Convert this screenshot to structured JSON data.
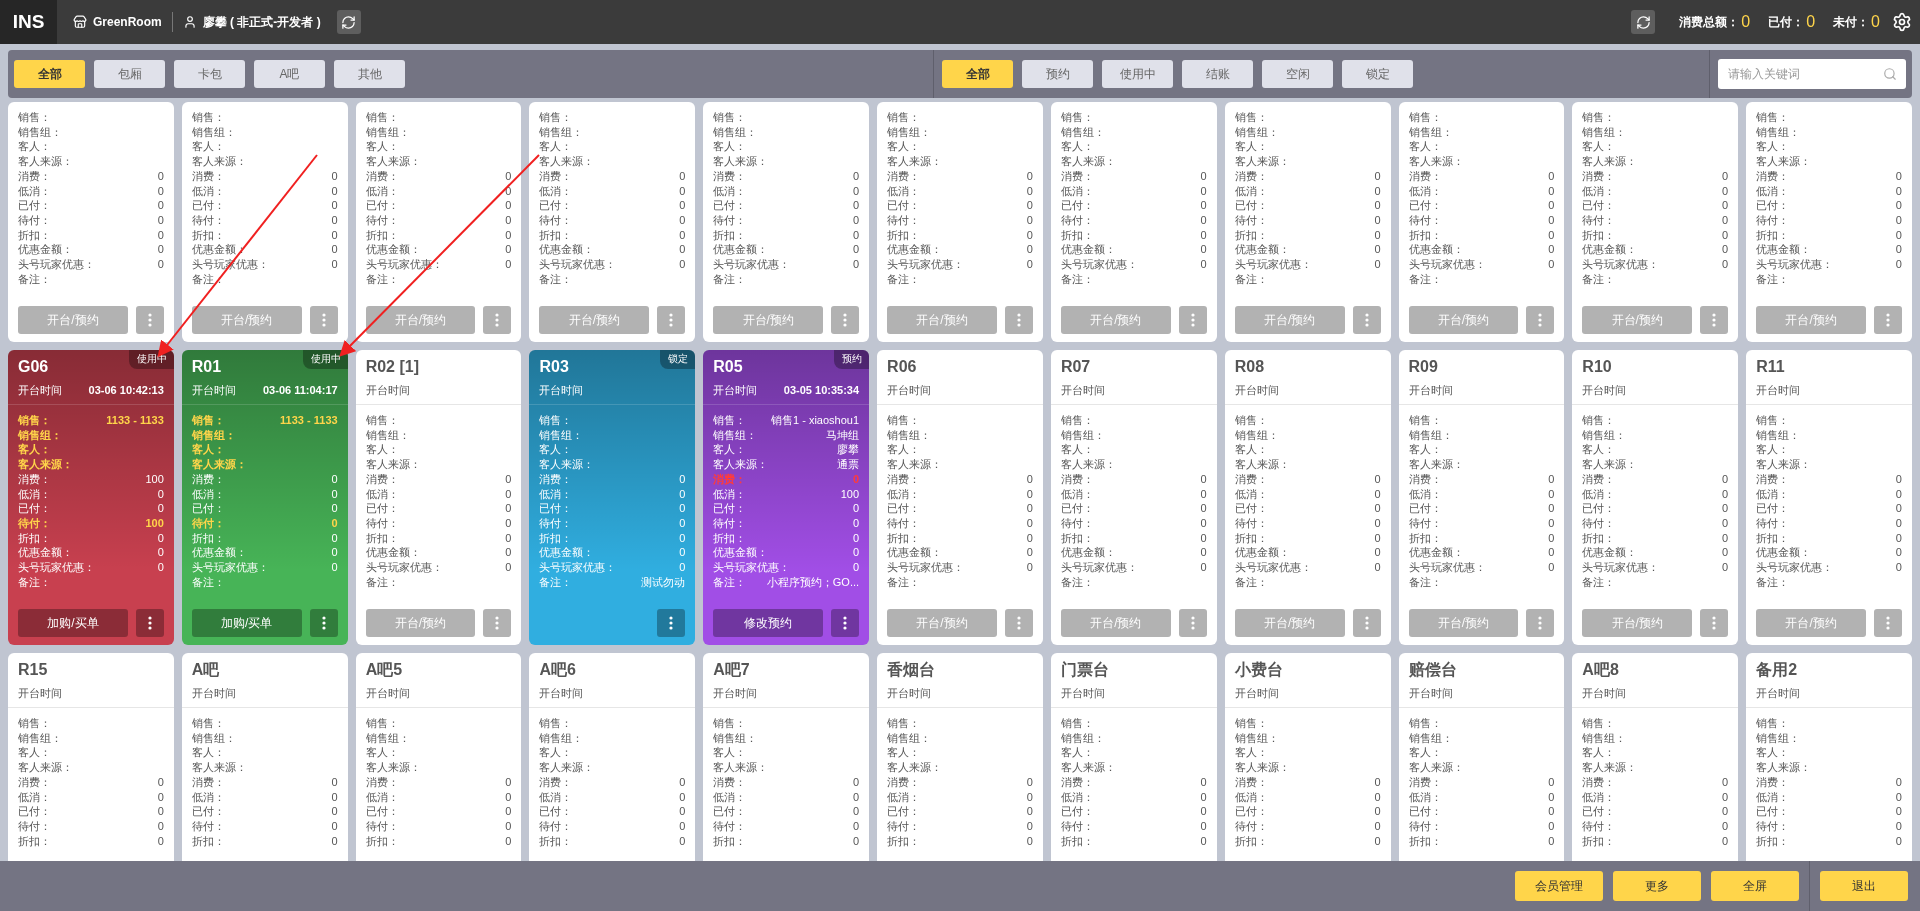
{
  "top_bar": {
    "logo": "INS",
    "store": "GreenRoom",
    "user": "廖攀 ( 非正式-开发者 )",
    "summary": [
      {
        "label": "消费总额：",
        "value": "0"
      },
      {
        "label": "已付：",
        "value": "0"
      },
      {
        "label": "未付：",
        "value": "0"
      }
    ]
  },
  "area_tabs": [
    {
      "label": "全部",
      "selected": true
    },
    {
      "label": "包厢",
      "selected": false
    },
    {
      "label": "卡包",
      "selected": false
    },
    {
      "label": "A吧",
      "selected": false
    },
    {
      "label": "其他",
      "selected": false
    }
  ],
  "status_tabs": [
    {
      "label": "全部",
      "selected": true
    },
    {
      "label": "预约",
      "selected": false
    },
    {
      "label": "使用中",
      "selected": false
    },
    {
      "label": "结账",
      "selected": false
    },
    {
      "label": "空闲",
      "selected": false
    },
    {
      "label": "锁定",
      "selected": false
    }
  ],
  "search": {
    "placeholder": "请输入关键词"
  },
  "rooms": [
    {
      "action": "开台/预约",
      "fields": [
        {
          "label": "销售："
        },
        {
          "label": "销售组："
        },
        {
          "label": "客人："
        },
        {
          "label": "客人来源："
        },
        {
          "label": "消费：",
          "value": "0"
        },
        {
          "label": "低消：",
          "value": "0"
        },
        {
          "label": "已付：",
          "value": "0"
        },
        {
          "label": "待付：",
          "value": "0"
        },
        {
          "label": "折扣：",
          "value": "0"
        },
        {
          "label": "优惠金额：",
          "value": "0"
        },
        {
          "label": "头号玩家优惠：",
          "value": "0"
        },
        {
          "label": "备注："
        }
      ]
    },
    {
      "action": "开台/预约",
      "fields": [
        {
          "label": "销售："
        },
        {
          "label": "销售组："
        },
        {
          "label": "客人："
        },
        {
          "label": "客人来源："
        },
        {
          "label": "消费：",
          "value": "0"
        },
        {
          "label": "低消：",
          "value": "0"
        },
        {
          "label": "已付：",
          "value": "0"
        },
        {
          "label": "待付：",
          "value": "0"
        },
        {
          "label": "折扣：",
          "value": "0"
        },
        {
          "label": "优惠金额：",
          "value": "0"
        },
        {
          "label": "头号玩家优惠：",
          "value": "0"
        },
        {
          "label": "备注："
        }
      ]
    },
    {
      "action": "开台/预约",
      "fields": [
        {
          "label": "销售："
        },
        {
          "label": "销售组："
        },
        {
          "label": "客人："
        },
        {
          "label": "客人来源："
        },
        {
          "label": "消费：",
          "value": "0"
        },
        {
          "label": "低消：",
          "value": "0"
        },
        {
          "label": "已付：",
          "value": "0"
        },
        {
          "label": "待付：",
          "value": "0"
        },
        {
          "label": "折扣：",
          "value": "0"
        },
        {
          "label": "优惠金额：",
          "value": "0"
        },
        {
          "label": "头号玩家优惠：",
          "value": "0"
        },
        {
          "label": "备注："
        }
      ]
    },
    {
      "action": "开台/预约",
      "fields": [
        {
          "label": "销售："
        },
        {
          "label": "销售组："
        },
        {
          "label": "客人："
        },
        {
          "label": "客人来源："
        },
        {
          "label": "消费：",
          "value": "0"
        },
        {
          "label": "低消：",
          "value": "0"
        },
        {
          "label": "已付：",
          "value": "0"
        },
        {
          "label": "待付：",
          "value": "0"
        },
        {
          "label": "折扣：",
          "value": "0"
        },
        {
          "label": "优惠金额：",
          "value": "0"
        },
        {
          "label": "头号玩家优惠：",
          "value": "0"
        },
        {
          "label": "备注："
        }
      ]
    },
    {
      "action": "开台/预约",
      "fields": [
        {
          "label": "销售："
        },
        {
          "label": "销售组："
        },
        {
          "label": "客人："
        },
        {
          "label": "客人来源："
        },
        {
          "label": "消费：",
          "value": "0"
        },
        {
          "label": "低消：",
          "value": "0"
        },
        {
          "label": "已付：",
          "value": "0"
        },
        {
          "label": "待付：",
          "value": "0"
        },
        {
          "label": "折扣：",
          "value": "0"
        },
        {
          "label": "优惠金额：",
          "value": "0"
        },
        {
          "label": "头号玩家优惠：",
          "value": "0"
        },
        {
          "label": "备注："
        }
      ]
    },
    {
      "action": "开台/预约",
      "fields": [
        {
          "label": "销售："
        },
        {
          "label": "销售组："
        },
        {
          "label": "客人："
        },
        {
          "label": "客人来源："
        },
        {
          "label": "消费：",
          "value": "0"
        },
        {
          "label": "低消：",
          "value": "0"
        },
        {
          "label": "已付：",
          "value": "0"
        },
        {
          "label": "待付：",
          "value": "0"
        },
        {
          "label": "折扣：",
          "value": "0"
        },
        {
          "label": "优惠金额：",
          "value": "0"
        },
        {
          "label": "头号玩家优惠：",
          "value": "0"
        },
        {
          "label": "备注："
        }
      ]
    },
    {
      "action": "开台/预约",
      "fields": [
        {
          "label": "销售："
        },
        {
          "label": "销售组："
        },
        {
          "label": "客人："
        },
        {
          "label": "客人来源："
        },
        {
          "label": "消费：",
          "value": "0"
        },
        {
          "label": "低消：",
          "value": "0"
        },
        {
          "label": "已付：",
          "value": "0"
        },
        {
          "label": "待付：",
          "value": "0"
        },
        {
          "label": "折扣：",
          "value": "0"
        },
        {
          "label": "优惠金额：",
          "value": "0"
        },
        {
          "label": "头号玩家优惠：",
          "value": "0"
        },
        {
          "label": "备注："
        }
      ]
    },
    {
      "action": "开台/预约",
      "fields": [
        {
          "label": "销售："
        },
        {
          "label": "销售组："
        },
        {
          "label": "客人："
        },
        {
          "label": "客人来源："
        },
        {
          "label": "消费：",
          "value": "0"
        },
        {
          "label": "低消：",
          "value": "0"
        },
        {
          "label": "已付：",
          "value": "0"
        },
        {
          "label": "待付：",
          "value": "0"
        },
        {
          "label": "折扣：",
          "value": "0"
        },
        {
          "label": "优惠金额：",
          "value": "0"
        },
        {
          "label": "头号玩家优惠：",
          "value": "0"
        },
        {
          "label": "备注："
        }
      ]
    },
    {
      "action": "开台/预约",
      "fields": [
        {
          "label": "销售："
        },
        {
          "label": "销售组："
        },
        {
          "label": "客人："
        },
        {
          "label": "客人来源："
        },
        {
          "label": "消费：",
          "value": "0"
        },
        {
          "label": "低消：",
          "value": "0"
        },
        {
          "label": "已付：",
          "value": "0"
        },
        {
          "label": "待付：",
          "value": "0"
        },
        {
          "label": "折扣：",
          "value": "0"
        },
        {
          "label": "优惠金额：",
          "value": "0"
        },
        {
          "label": "头号玩家优惠：",
          "value": "0"
        },
        {
          "label": "备注："
        }
      ]
    },
    {
      "action": "开台/预约",
      "fields": [
        {
          "label": "销售："
        },
        {
          "label": "销售组："
        },
        {
          "label": "客人："
        },
        {
          "label": "客人来源："
        },
        {
          "label": "消费：",
          "value": "0"
        },
        {
          "label": "低消：",
          "value": "0"
        },
        {
          "label": "已付：",
          "value": "0"
        },
        {
          "label": "待付：",
          "value": "0"
        },
        {
          "label": "折扣：",
          "value": "0"
        },
        {
          "label": "优惠金额：",
          "value": "0"
        },
        {
          "label": "头号玩家优惠：",
          "value": "0"
        },
        {
          "label": "备注："
        }
      ]
    },
    {
      "action": "开台/预约",
      "fields": [
        {
          "label": "销售："
        },
        {
          "label": "销售组："
        },
        {
          "label": "客人："
        },
        {
          "label": "客人来源："
        },
        {
          "label": "消费：",
          "value": "0"
        },
        {
          "label": "低消：",
          "value": "0"
        },
        {
          "label": "已付：",
          "value": "0"
        },
        {
          "label": "待付：",
          "value": "0"
        },
        {
          "label": "折扣：",
          "value": "0"
        },
        {
          "label": "优惠金额：",
          "value": "0"
        },
        {
          "label": "头号玩家优惠：",
          "value": "0"
        },
        {
          "label": "备注："
        }
      ]
    },
    {
      "title": "G06",
      "badge": "使用中",
      "color": "#c8404f",
      "open_time_label": "开台时间",
      "open_time": "03-06 10:42:13",
      "action": "加购/买单",
      "fields": [
        {
          "label": "销售：",
          "value": "1133 - 1133",
          "color": "#ffd54a"
        },
        {
          "label": "销售组：",
          "color": "#ffd54a"
        },
        {
          "label": "客人：",
          "color": "#ffd54a"
        },
        {
          "label": "客人来源：",
          "color": "#ffd54a"
        },
        {
          "label": "消费：",
          "value": "100"
        },
        {
          "label": "低消：",
          "value": "0"
        },
        {
          "label": "已付：",
          "value": "0"
        },
        {
          "label": "待付：",
          "value": "100",
          "color": "#ffd54a"
        },
        {
          "label": "折扣：",
          "value": "0"
        },
        {
          "label": "优惠金额：",
          "value": "0"
        },
        {
          "label": "头号玩家优惠：",
          "value": "0"
        },
        {
          "label": "备注："
        }
      ]
    },
    {
      "title": "R01",
      "badge": "使用中",
      "color": "#47b457",
      "open_time_label": "开台时间",
      "open_time": "03-06 11:04:17",
      "action": "加购/买单",
      "fields": [
        {
          "label": "销售：",
          "value": "1133 - 1133",
          "color": "#ffd54a"
        },
        {
          "label": "销售组：",
          "color": "#ffd54a"
        },
        {
          "label": "客人：",
          "color": "#ffd54a"
        },
        {
          "label": "客人来源：",
          "color": "#ffd54a"
        },
        {
          "label": "消费：",
          "value": "0"
        },
        {
          "label": "低消：",
          "value": "0"
        },
        {
          "label": "已付：",
          "value": "0"
        },
        {
          "label": "待付：",
          "value": "0",
          "color": "#ffd54a"
        },
        {
          "label": "折扣：",
          "value": "0"
        },
        {
          "label": "优惠金额：",
          "value": "0"
        },
        {
          "label": "头号玩家优惠：",
          "value": "0"
        },
        {
          "label": "备注："
        }
      ]
    },
    {
      "title": "R02 [1]",
      "open_time_label": "开台时间",
      "action": "开台/预约",
      "fields": [
        {
          "label": "销售："
        },
        {
          "label": "销售组："
        },
        {
          "label": "客人："
        },
        {
          "label": "客人来源："
        },
        {
          "label": "消费：",
          "value": "0"
        },
        {
          "label": "低消：",
          "value": "0"
        },
        {
          "label": "已付：",
          "value": "0"
        },
        {
          "label": "待付：",
          "value": "0"
        },
        {
          "label": "折扣：",
          "value": "0"
        },
        {
          "label": "优惠金额：",
          "value": "0"
        },
        {
          "label": "头号玩家优惠：",
          "value": "0"
        },
        {
          "label": "备注："
        }
      ]
    },
    {
      "title": "R03",
      "badge": "锁定",
      "color": "#30aee0",
      "open_time_label": "开台时间",
      "fields": [
        {
          "label": "销售："
        },
        {
          "label": "销售组："
        },
        {
          "label": "客人："
        },
        {
          "label": "客人来源："
        },
        {
          "label": "消费：",
          "value": "0"
        },
        {
          "label": "低消：",
          "value": "0"
        },
        {
          "label": "已付：",
          "value": "0"
        },
        {
          "label": "待付：",
          "value": "0"
        },
        {
          "label": "折扣：",
          "value": "0"
        },
        {
          "label": "优惠金额：",
          "value": "0"
        },
        {
          "label": "头号玩家优惠：",
          "value": "0"
        },
        {
          "label": "备注：",
          "value": "测试勿动"
        }
      ]
    },
    {
      "title": "R05",
      "badge": "预约",
      "color": "#a14ee6",
      "open_time_label": "开台时间",
      "open_time": "03-05 10:35:34",
      "action": "修改预约",
      "fields": [
        {
          "label": "销售：",
          "value": "销售1 - xiaoshou1"
        },
        {
          "label": "销售组：",
          "value": "马坤组"
        },
        {
          "label": "客人：",
          "value": "廖攀"
        },
        {
          "label": "客人来源：",
          "value": "通票"
        },
        {
          "label": "消费：",
          "value": "0",
          "color": "#ff3b3b"
        },
        {
          "label": "低消：",
          "value": "100"
        },
        {
          "label": "已付：",
          "value": "0"
        },
        {
          "label": "待付：",
          "value": "0"
        },
        {
          "label": "折扣：",
          "value": "0"
        },
        {
          "label": "优惠金额：",
          "value": "0"
        },
        {
          "label": "头号玩家优惠：",
          "value": "0"
        },
        {
          "label": "备注：",
          "value": "小程序预约；GO..."
        }
      ]
    },
    {
      "title": "R06",
      "open_time_label": "开台时间",
      "action": "开台/预约",
      "fields": [
        {
          "label": "销售："
        },
        {
          "label": "销售组："
        },
        {
          "label": "客人："
        },
        {
          "label": "客人来源："
        },
        {
          "label": "消费：",
          "value": "0"
        },
        {
          "label": "低消：",
          "value": "0"
        },
        {
          "label": "已付：",
          "value": "0"
        },
        {
          "label": "待付：",
          "value": "0"
        },
        {
          "label": "折扣：",
          "value": "0"
        },
        {
          "label": "优惠金额：",
          "value": "0"
        },
        {
          "label": "头号玩家优惠：",
          "value": "0"
        },
        {
          "label": "备注："
        }
      ]
    },
    {
      "title": "R07",
      "open_time_label": "开台时间",
      "action": "开台/预约",
      "fields": [
        {
          "label": "销售："
        },
        {
          "label": "销售组："
        },
        {
          "label": "客人："
        },
        {
          "label": "客人来源："
        },
        {
          "label": "消费：",
          "value": "0"
        },
        {
          "label": "低消：",
          "value": "0"
        },
        {
          "label": "已付：",
          "value": "0"
        },
        {
          "label": "待付：",
          "value": "0"
        },
        {
          "label": "折扣：",
          "value": "0"
        },
        {
          "label": "优惠金额：",
          "value": "0"
        },
        {
          "label": "头号玩家优惠：",
          "value": "0"
        },
        {
          "label": "备注："
        }
      ]
    },
    {
      "title": "R08",
      "open_time_label": "开台时间",
      "action": "开台/预约",
      "fields": [
        {
          "label": "销售："
        },
        {
          "label": "销售组："
        },
        {
          "label": "客人："
        },
        {
          "label": "客人来源："
        },
        {
          "label": "消费：",
          "value": "0"
        },
        {
          "label": "低消：",
          "value": "0"
        },
        {
          "label": "已付：",
          "value": "0"
        },
        {
          "label": "待付：",
          "value": "0"
        },
        {
          "label": "折扣：",
          "value": "0"
        },
        {
          "label": "优惠金额：",
          "value": "0"
        },
        {
          "label": "头号玩家优惠：",
          "value": "0"
        },
        {
          "label": "备注："
        }
      ]
    },
    {
      "title": "R09",
      "open_time_label": "开台时间",
      "action": "开台/预约",
      "fields": [
        {
          "label": "销售："
        },
        {
          "label": "销售组："
        },
        {
          "label": "客人："
        },
        {
          "label": "客人来源："
        },
        {
          "label": "消费：",
          "value": "0"
        },
        {
          "label": "低消：",
          "value": "0"
        },
        {
          "label": "已付：",
          "value": "0"
        },
        {
          "label": "待付：",
          "value": "0"
        },
        {
          "label": "折扣：",
          "value": "0"
        },
        {
          "label": "优惠金额：",
          "value": "0"
        },
        {
          "label": "头号玩家优惠：",
          "value": "0"
        },
        {
          "label": "备注："
        }
      ]
    },
    {
      "title": "R10",
      "open_time_label": "开台时间",
      "action": "开台/预约",
      "fields": [
        {
          "label": "销售："
        },
        {
          "label": "销售组："
        },
        {
          "label": "客人："
        },
        {
          "label": "客人来源："
        },
        {
          "label": "消费：",
          "value": "0"
        },
        {
          "label": "低消：",
          "value": "0"
        },
        {
          "label": "已付：",
          "value": "0"
        },
        {
          "label": "待付：",
          "value": "0"
        },
        {
          "label": "折扣：",
          "value": "0"
        },
        {
          "label": "优惠金额：",
          "value": "0"
        },
        {
          "label": "头号玩家优惠：",
          "value": "0"
        },
        {
          "label": "备注："
        }
      ]
    },
    {
      "title": "R11",
      "open_time_label": "开台时间",
      "action": "开台/预约",
      "fields": [
        {
          "label": "销售："
        },
        {
          "label": "销售组："
        },
        {
          "label": "客人："
        },
        {
          "label": "客人来源："
        },
        {
          "label": "消费：",
          "value": "0"
        },
        {
          "label": "低消：",
          "value": "0"
        },
        {
          "label": "已付：",
          "value": "0"
        },
        {
          "label": "待付：",
          "value": "0"
        },
        {
          "label": "折扣：",
          "value": "0"
        },
        {
          "label": "优惠金额：",
          "value": "0"
        },
        {
          "label": "头号玩家优惠：",
          "value": "0"
        },
        {
          "label": "备注："
        }
      ]
    },
    {
      "title": "R15",
      "open_time_label": "开台时间",
      "fields": [
        {
          "label": "销售："
        },
        {
          "label": "销售组："
        },
        {
          "label": "客人："
        },
        {
          "label": "客人来源："
        },
        {
          "label": "消费：",
          "value": "0"
        },
        {
          "label": "低消：",
          "value": "0"
        },
        {
          "label": "已付：",
          "value": "0"
        },
        {
          "label": "待付：",
          "value": "0"
        },
        {
          "label": "折扣：",
          "value": "0"
        }
      ]
    },
    {
      "title": "A吧",
      "open_time_label": "开台时间",
      "fields": [
        {
          "label": "销售："
        },
        {
          "label": "销售组："
        },
        {
          "label": "客人："
        },
        {
          "label": "客人来源："
        },
        {
          "label": "消费：",
          "value": "0"
        },
        {
          "label": "低消：",
          "value": "0"
        },
        {
          "label": "已付：",
          "value": "0"
        },
        {
          "label": "待付：",
          "value": "0"
        },
        {
          "label": "折扣：",
          "value": "0"
        }
      ]
    },
    {
      "title": "A吧5",
      "open_time_label": "开台时间",
      "fields": [
        {
          "label": "销售："
        },
        {
          "label": "销售组："
        },
        {
          "label": "客人："
        },
        {
          "label": "客人来源："
        },
        {
          "label": "消费：",
          "value": "0"
        },
        {
          "label": "低消：",
          "value": "0"
        },
        {
          "label": "已付：",
          "value": "0"
        },
        {
          "label": "待付：",
          "value": "0"
        },
        {
          "label": "折扣：",
          "value": "0"
        }
      ]
    },
    {
      "title": "A吧6",
      "open_time_label": "开台时间",
      "fields": [
        {
          "label": "销售："
        },
        {
          "label": "销售组："
        },
        {
          "label": "客人："
        },
        {
          "label": "客人来源："
        },
        {
          "label": "消费：",
          "value": "0"
        },
        {
          "label": "低消：",
          "value": "0"
        },
        {
          "label": "已付：",
          "value": "0"
        },
        {
          "label": "待付：",
          "value": "0"
        },
        {
          "label": "折扣：",
          "value": "0"
        }
      ]
    },
    {
      "title": "A吧7",
      "open_time_label": "开台时间",
      "fields": [
        {
          "label": "销售："
        },
        {
          "label": "销售组："
        },
        {
          "label": "客人："
        },
        {
          "label": "客人来源："
        },
        {
          "label": "消费：",
          "value": "0"
        },
        {
          "label": "低消：",
          "value": "0"
        },
        {
          "label": "已付：",
          "value": "0"
        },
        {
          "label": "待付：",
          "value": "0"
        },
        {
          "label": "折扣：",
          "value": "0"
        }
      ]
    },
    {
      "title": "香烟台",
      "open_time_label": "开台时间",
      "fields": [
        {
          "label": "销售："
        },
        {
          "label": "销售组："
        },
        {
          "label": "客人："
        },
        {
          "label": "客人来源："
        },
        {
          "label": "消费：",
          "value": "0"
        },
        {
          "label": "低消：",
          "value": "0"
        },
        {
          "label": "已付：",
          "value": "0"
        },
        {
          "label": "待付：",
          "value": "0"
        },
        {
          "label": "折扣：",
          "value": "0"
        }
      ]
    },
    {
      "title": "门票台",
      "open_time_label": "开台时间",
      "fields": [
        {
          "label": "销售："
        },
        {
          "label": "销售组："
        },
        {
          "label": "客人："
        },
        {
          "label": "客人来源："
        },
        {
          "label": "消费：",
          "value": "0"
        },
        {
          "label": "低消：",
          "value": "0"
        },
        {
          "label": "已付：",
          "value": "0"
        },
        {
          "label": "待付：",
          "value": "0"
        },
        {
          "label": "折扣：",
          "value": "0"
        }
      ]
    },
    {
      "title": "小费台",
      "open_time_label": "开台时间",
      "fields": [
        {
          "label": "销售："
        },
        {
          "label": "销售组："
        },
        {
          "label": "客人："
        },
        {
          "label": "客人来源："
        },
        {
          "label": "消费：",
          "value": "0"
        },
        {
          "label": "低消：",
          "value": "0"
        },
        {
          "label": "已付：",
          "value": "0"
        },
        {
          "label": "待付：",
          "value": "0"
        },
        {
          "label": "折扣：",
          "value": "0"
        }
      ]
    },
    {
      "title": "赔偿台",
      "open_time_label": "开台时间",
      "fields": [
        {
          "label": "销售："
        },
        {
          "label": "销售组："
        },
        {
          "label": "客人："
        },
        {
          "label": "客人来源："
        },
        {
          "label": "消费：",
          "value": "0"
        },
        {
          "label": "低消：",
          "value": "0"
        },
        {
          "label": "已付：",
          "value": "0"
        },
        {
          "label": "待付：",
          "value": "0"
        },
        {
          "label": "折扣：",
          "value": "0"
        }
      ]
    },
    {
      "title": "A吧8",
      "open_time_label": "开台时间",
      "fields": [
        {
          "label": "销售："
        },
        {
          "label": "销售组："
        },
        {
          "label": "客人："
        },
        {
          "label": "客人来源："
        },
        {
          "label": "消费：",
          "value": "0"
        },
        {
          "label": "低消：",
          "value": "0"
        },
        {
          "label": "已付：",
          "value": "0"
        },
        {
          "label": "待付：",
          "value": "0"
        },
        {
          "label": "折扣：",
          "value": "0"
        }
      ]
    },
    {
      "title": "备用2",
      "open_time_label": "开台时间",
      "fields": [
        {
          "label": "销售："
        },
        {
          "label": "销售组："
        },
        {
          "label": "客人："
        },
        {
          "label": "客人来源："
        },
        {
          "label": "消费：",
          "value": "0"
        },
        {
          "label": "低消：",
          "value": "0"
        },
        {
          "label": "已付：",
          "value": "0"
        },
        {
          "label": "待付：",
          "value": "0"
        },
        {
          "label": "折扣：",
          "value": "0"
        }
      ]
    }
  ],
  "footer": {
    "buttons": [
      "会员管理",
      "更多",
      "全屏"
    ],
    "exit": "退出"
  }
}
